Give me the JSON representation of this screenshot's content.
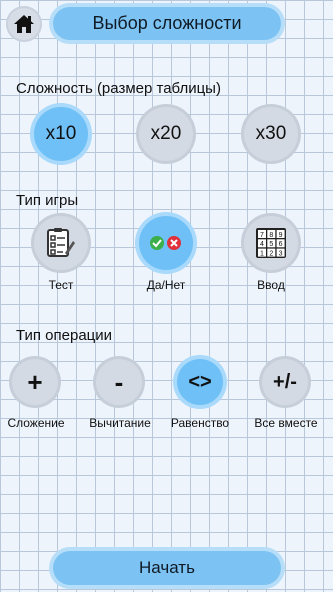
{
  "header": {
    "title": "Выбор сложности"
  },
  "difficulty": {
    "label": "Сложность (размер таблицы)",
    "options": [
      "x10",
      "x20",
      "x30"
    ]
  },
  "game_type": {
    "label": "Тип игры",
    "options": [
      "Тест",
      "Да/Нет",
      "Ввод"
    ]
  },
  "operation": {
    "label": "Тип операции",
    "symbols": [
      "+",
      "-",
      "<>",
      "+/-"
    ],
    "options": [
      "Сложение",
      "Вычитание",
      "Равенство",
      "Все вместе"
    ]
  },
  "keypad_digits": [
    "7",
    "8",
    "9",
    "4",
    "5",
    "6",
    "1",
    "2",
    "3"
  ],
  "start_label": "Начать",
  "colors": {
    "accent": "#6ec0f6",
    "grid": "#b8c7d9",
    "inactive": "#d4dae3"
  }
}
